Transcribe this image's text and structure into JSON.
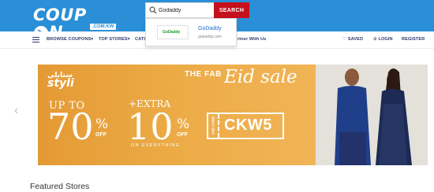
{
  "header": {
    "logo_text_1": "COUP",
    "logo_text_2": "N",
    "logo_badge": ".COM.KW",
    "brand_color": "#2a8fd6"
  },
  "search": {
    "value": "Godaddy",
    "button_label": "SEARCH",
    "button_color": "#c4111d"
  },
  "suggestion": {
    "logo_text": "GoDaddy",
    "name": "GoDaddy",
    "url": "godaddy.com"
  },
  "nav": {
    "browse": "BROWSE COUPONS",
    "top_stores": "TOP STORES",
    "categories": "CATI",
    "partner": "rtner With Us",
    "saved": "SAVED",
    "login": "LOGIN",
    "register": "REGISTER"
  },
  "banner": {
    "brand_ar": "ستايلي",
    "brand": "styli",
    "fab": "THE FAB",
    "eid": "Eid sale",
    "upto": "UP TO",
    "discount1": "70",
    "percent1": "%",
    "off1": "OFF",
    "extra": "+EXTRA",
    "discount2": "10",
    "percent2": "%",
    "off2": "OFF",
    "on_everything": "ON EVERYTHING",
    "code_label": "USE CODE",
    "code": "CKW5"
  },
  "carousel": {
    "prev": "‹",
    "next": "›"
  },
  "featured": {
    "title": "Featured Stores"
  }
}
